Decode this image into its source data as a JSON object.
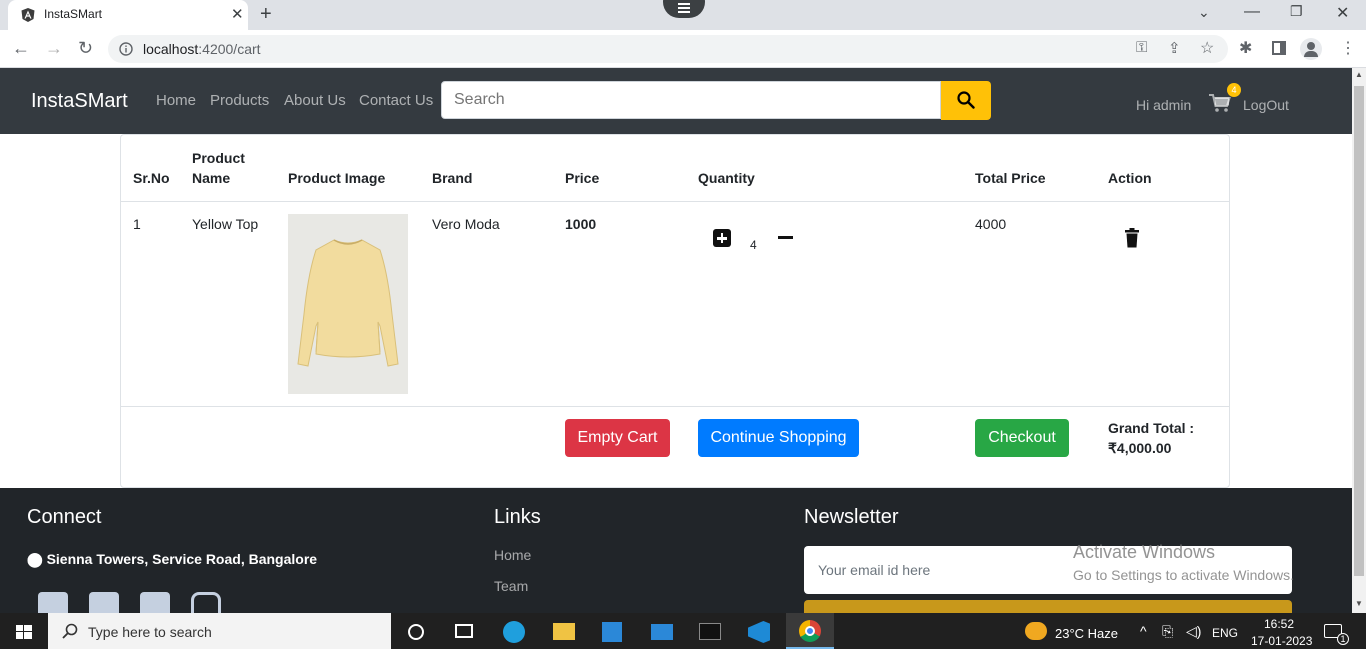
{
  "browser": {
    "tab_title": "InstaSMart",
    "url_host": "localhost",
    "url_rest": ":4200/cart"
  },
  "navbar": {
    "brand": "InstaSMart",
    "links": [
      "Home",
      "Products",
      "About Us",
      "Contact Us"
    ],
    "search_placeholder": "Search",
    "greeting": "Hi admin",
    "cart_count": "4",
    "logout": "LogOut"
  },
  "cart": {
    "headers": {
      "srno": "Sr.No",
      "product_name_1": "Product",
      "product_name_2": "Name",
      "image": "Product Image",
      "brand": "Brand",
      "price": "Price",
      "quantity": "Quantity",
      "total": "Total Price",
      "action": "Action"
    },
    "rows": [
      {
        "srno": "1",
        "name": "Yellow Top",
        "brand": "Vero Moda",
        "price": "1000",
        "quantity": "4",
        "total": "4000"
      }
    ],
    "empty_cart": "Empty Cart",
    "continue": "Continue Shopping",
    "checkout": "Checkout",
    "grand_total_label": "Grand Total :",
    "grand_total_value": "₹4,000.00"
  },
  "footer": {
    "connect_title": "Connect",
    "address": "Sienna Towers, Service Road, Bangalore",
    "links_title": "Links",
    "links": [
      "Home",
      "Team"
    ],
    "newsletter_title": "Newsletter",
    "email_placeholder": "Your email id here",
    "watermark_1": "Activate Windows",
    "watermark_2": "Go to Settings to activate Windows."
  },
  "taskbar": {
    "search_text": "Type here to search",
    "weather": "23°C  Haze",
    "lang": "ENG",
    "time": "16:52",
    "date": "17-01-2023",
    "notif_count": "1"
  },
  "colors": {
    "navbar": "#343a40",
    "accent": "#ffc107",
    "danger": "#dc3545",
    "primary": "#007bff",
    "success": "#28a745",
    "footer": "#212529"
  }
}
